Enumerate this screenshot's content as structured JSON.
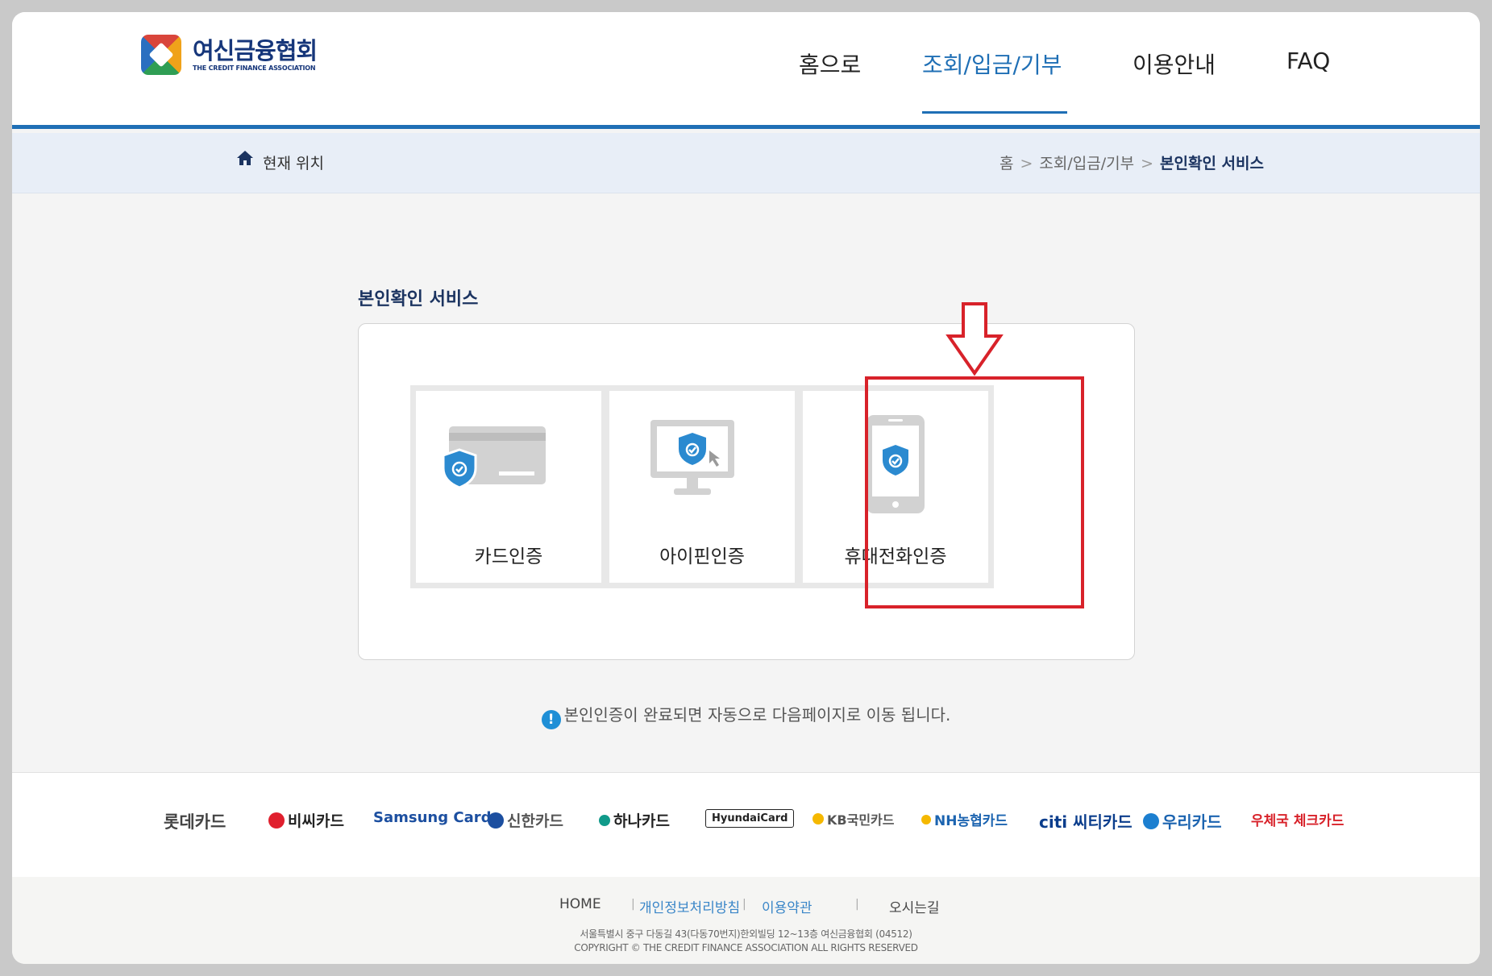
{
  "header": {
    "logo_kor": "여신금융협회",
    "logo_eng": "THE CREDIT FINANCE ASSOCIATION",
    "nav": [
      {
        "label": "홈으로"
      },
      {
        "label": "조회/입금/기부"
      },
      {
        "label": "이용안내"
      },
      {
        "label": "FAQ"
      }
    ],
    "active_index": 1
  },
  "breadcrumb": {
    "label": "현재 위치",
    "items": [
      "홈",
      "조회/입금/기부",
      "본인확인 서비스"
    ],
    "separator": ">"
  },
  "main": {
    "title": "본인확인 서비스",
    "options": [
      {
        "label": "카드인증",
        "icon": "card-shield-icon"
      },
      {
        "label": "아이핀인증",
        "icon": "monitor-shield-icon"
      },
      {
        "label": "휴대전화인증",
        "icon": "phone-shield-icon"
      }
    ],
    "highlighted_index": 2,
    "notice_icon": "!",
    "notice": "본인인증이 완료되면 자동으로 다음페이지로 이동 됩니다."
  },
  "card_logos": [
    {
      "text": "롯데카드",
      "color": "#444444"
    },
    {
      "text": "비씨카드",
      "color": "#222222"
    },
    {
      "text": "Samsung Card",
      "color": "#1c4fa0"
    },
    {
      "text": "신한카드",
      "color": "#555555"
    },
    {
      "text": "하나카드",
      "color": "#222222"
    },
    {
      "text": "HyundaiCard",
      "color": "#222222"
    },
    {
      "text": "KB국민카드",
      "color": "#555555"
    },
    {
      "text": "NH농협카드",
      "color": "#1c64b0"
    },
    {
      "text": "citi 씨티카드",
      "color": "#0a3d8c"
    },
    {
      "text": "우리카드",
      "color": "#1c64b0"
    },
    {
      "text": "우체국 체크카드",
      "color": "#d8222a"
    }
  ],
  "footer": {
    "links": [
      {
        "label": "HOME"
      },
      {
        "label": "개인정보처리방침"
      },
      {
        "label": "이용약관"
      },
      {
        "label": "오시는길"
      }
    ],
    "separator": "|",
    "address": "서울특별시 중구 다동길 43(다동70번지)한외빌딩 12~13층 여신금융협회 (04512)",
    "copyright": "COPYRIGHT © THE CREDIT FINANCE ASSOCIATION ALL RIGHTS RESERVED"
  },
  "colors": {
    "accent": "#1f6fb5",
    "highlight": "#d8222a",
    "shield": "#2b8ad0"
  }
}
